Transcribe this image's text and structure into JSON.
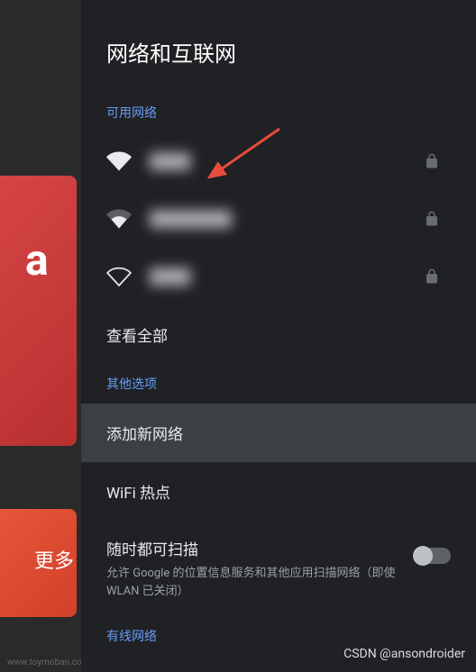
{
  "background": {
    "letter": "a",
    "more_text": "更多",
    "footer_text": "www.toymoban.com"
  },
  "page": {
    "title": "网络和互联网"
  },
  "sections": {
    "available_networks": "可用网络",
    "other_options": "其他选项",
    "wired_network": "有线网络"
  },
  "networks": [
    {
      "name": "████",
      "signal": 3,
      "secured": true
    },
    {
      "name": "████████",
      "signal": 2,
      "secured": true
    },
    {
      "name": "████",
      "signal": 1,
      "secured": true
    }
  ],
  "actions": {
    "view_all": "查看全部",
    "add_network": "添加新网络",
    "wifi_hotspot": "WiFi 热点"
  },
  "scan": {
    "title": "随时都可扫描",
    "subtitle": "允许 Google 的位置信息服务和其他应用扫描网络（即使 WLAN 已关闭）",
    "enabled": false
  },
  "watermark": "CSDN @ansondroider"
}
